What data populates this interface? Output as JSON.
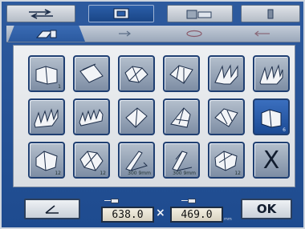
{
  "top_tabs": [
    {
      "icon": "arrows-icon",
      "active": false
    },
    {
      "icon": "folder-tab-icon",
      "active": true
    },
    {
      "icon": "paper-feed-icon",
      "active": false
    },
    {
      "icon": "person-icon",
      "active": false
    }
  ],
  "sub_tabs": [
    {
      "icon": "fold-type-icon",
      "active": true
    },
    {
      "icon": "fold-option-2-icon",
      "active": false
    },
    {
      "icon": "fold-option-3-icon",
      "active": false
    },
    {
      "icon": "fold-option-4-icon",
      "active": false
    }
  ],
  "fold_types": [
    {
      "icon": "single-fold-icon",
      "index": "1"
    },
    {
      "icon": "sheet-fold-icon",
      "index": ""
    },
    {
      "icon": "letter-fold-icon",
      "index": ""
    },
    {
      "icon": "z-fold-icon",
      "index": ""
    },
    {
      "icon": "double-parallel-fold-icon",
      "index": ""
    },
    {
      "icon": "accordion-fold-icon",
      "index": ""
    },
    {
      "icon": "multi-fold-icon",
      "index": ""
    },
    {
      "icon": "zigzag-fold-icon",
      "index": ""
    },
    {
      "icon": "gate-fold-icon",
      "index": ""
    },
    {
      "icon": "cross-fold-icon",
      "index": ""
    },
    {
      "icon": "roll-fold-icon",
      "index": ""
    },
    {
      "icon": "half-fold-icon",
      "index": "6",
      "selected": true
    },
    {
      "icon": "tri-fold-icon",
      "index": "12"
    },
    {
      "icon": "french-fold-icon",
      "index": "12"
    },
    {
      "icon": "long-fold-a-icon",
      "index": "300 9mm"
    },
    {
      "icon": "long-fold-b-icon",
      "index": "300 9mm"
    },
    {
      "icon": "special-fold-icon",
      "index": "12"
    },
    {
      "icon": "cancel-icon",
      "label": "X"
    }
  ],
  "bottom": {
    "width_value": "638.0",
    "height_value": "469.0",
    "times": "×",
    "unit": "mm",
    "ok_label": "OK"
  },
  "colors": {
    "frame": "#1e4b8f",
    "panel": "#e4e7eb",
    "button": "#8f9db0",
    "button_selected": "#2b5ea8"
  }
}
